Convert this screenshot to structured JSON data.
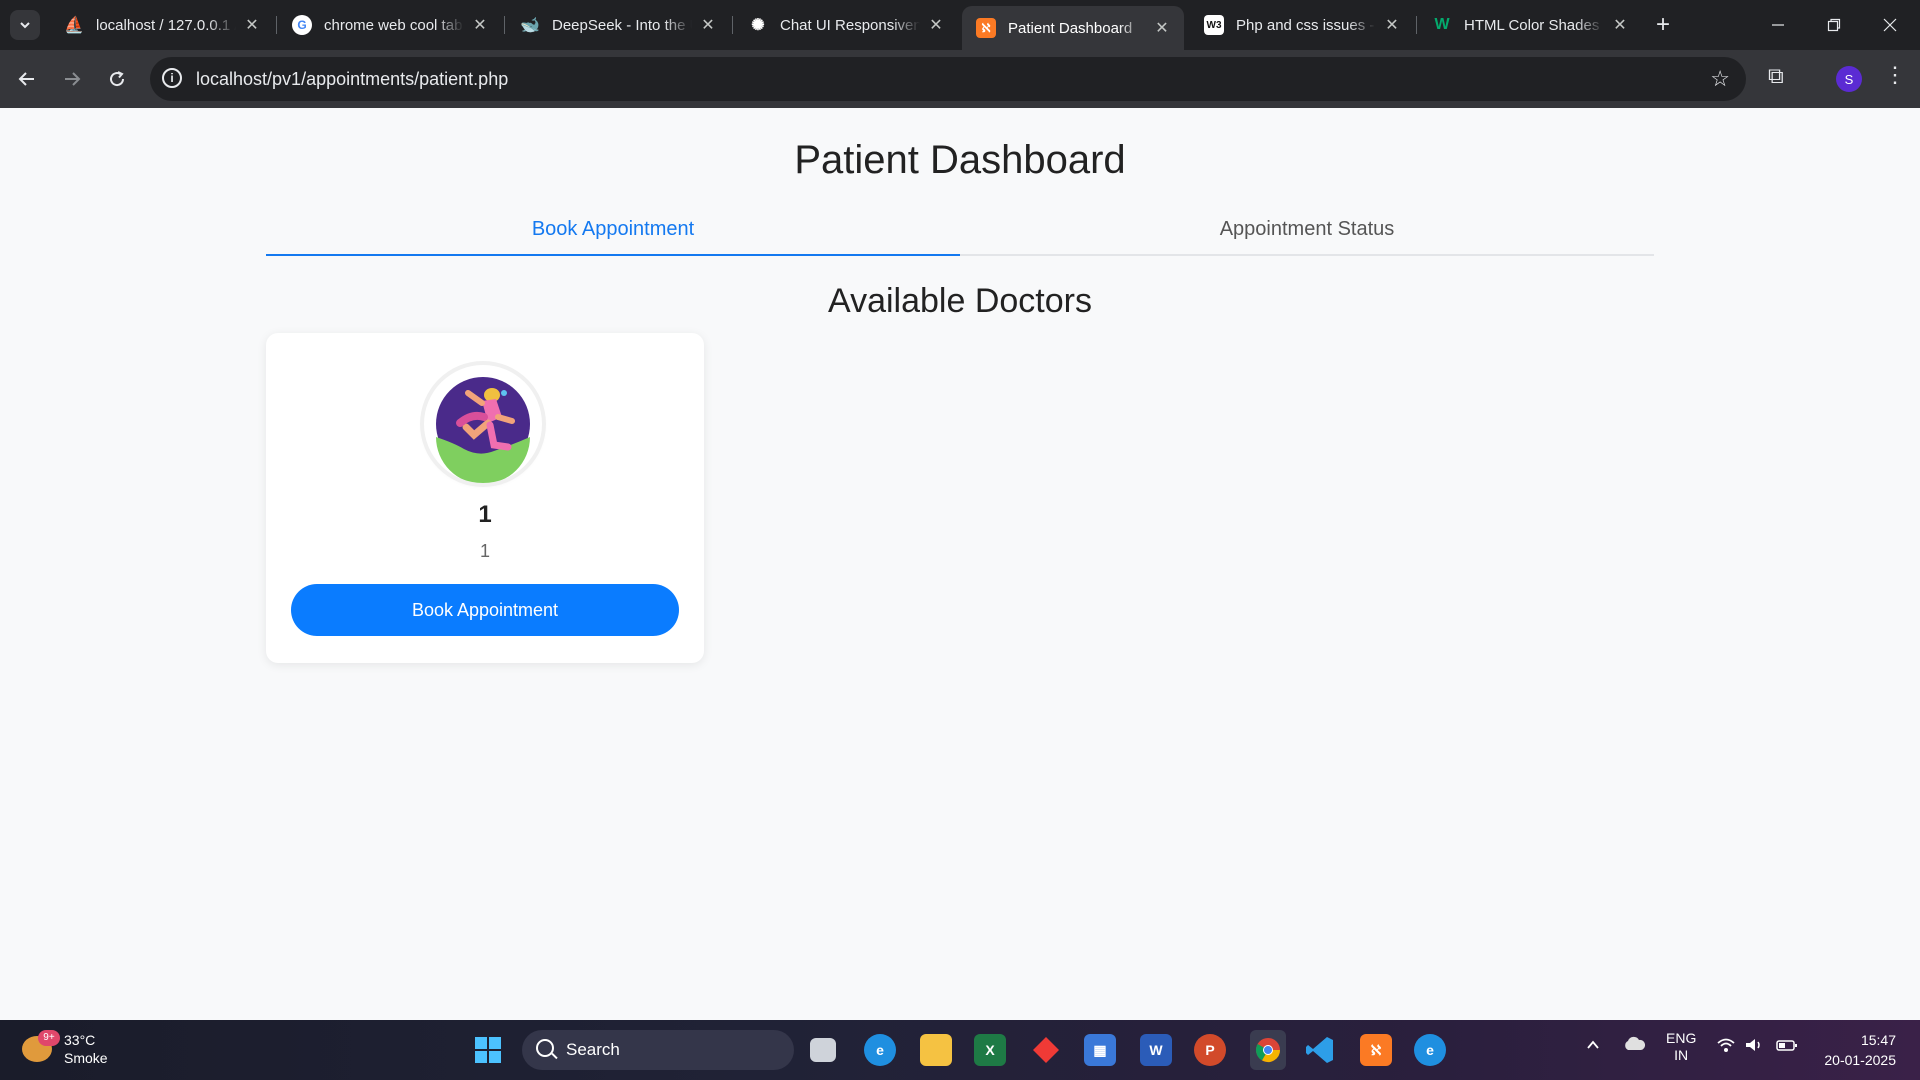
{
  "browser": {
    "tabs": [
      {
        "title": "localhost / 127.0.0.1 / ...",
        "favicon": "phpmyadmin-icon",
        "active": false
      },
      {
        "title": "chrome web cool tab",
        "favicon": "google-icon",
        "active": false
      },
      {
        "title": "DeepSeek - Into the U",
        "favicon": "deepseek-icon",
        "active": false
      },
      {
        "title": "Chat UI Responsivene",
        "favicon": "chatgpt-icon",
        "active": false
      },
      {
        "title": "Patient Dashboard",
        "favicon": "xampp-icon",
        "active": true
      },
      {
        "title": "Php and css issues - ",
        "favicon": "w3-icon",
        "active": false
      },
      {
        "title": "HTML Color Shades",
        "favicon": "w3schools-icon",
        "active": false
      }
    ],
    "url": "localhost/pv1/appointments/patient.php",
    "profile_initial": "S"
  },
  "page": {
    "title": "Patient Dashboard",
    "tabs": [
      {
        "label": "Book Appointment",
        "active": true
      },
      {
        "label": "Appointment Status",
        "active": false
      }
    ],
    "section_title": "Available Doctors",
    "doctors": [
      {
        "name": "1",
        "specialization": "1",
        "button_label": "Book Appointment"
      }
    ]
  },
  "taskbar": {
    "weather": {
      "temp": "33°C",
      "condition": "Smoke",
      "badge": "9+"
    },
    "search_placeholder": "Search",
    "language": {
      "line1": "ENG",
      "line2": "IN"
    },
    "time": "15:47",
    "date": "20-01-2025"
  },
  "colors": {
    "accent": "#1479f0",
    "button": "#0a7cff",
    "page_bg": "#f8f9fa"
  }
}
